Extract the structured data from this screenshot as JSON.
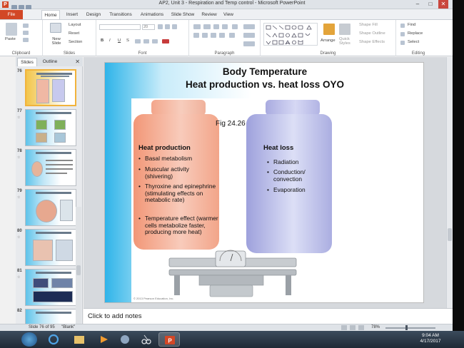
{
  "window": {
    "title": "AP2, Unit 3 - Respiration and Temp control - Microsoft PowerPoint"
  },
  "tabs": [
    "File",
    "Home",
    "Insert",
    "Design",
    "Transitions",
    "Animations",
    "Slide Show",
    "Review",
    "View"
  ],
  "ribbon": {
    "clipboard": {
      "label": "Clipboard",
      "paste": "Paste"
    },
    "slides": {
      "label": "Slides",
      "new_slide": "New Slide",
      "layout": "Layout",
      "reset": "Reset",
      "section": "Section"
    },
    "font": {
      "label": "Font",
      "size": "20"
    },
    "paragraph": {
      "label": "Paragraph"
    },
    "drawing": {
      "label": "Drawing",
      "arrange": "Arrange",
      "quick_styles": "Quick Styles",
      "shape_fill": "Shape Fill",
      "shape_outline": "Shape Outline",
      "shape_effects": "Shape Effects"
    },
    "editing": {
      "label": "Editing",
      "find": "Find",
      "replace": "Replace",
      "select": "Select"
    }
  },
  "left_pane": {
    "tabs": [
      "Slides",
      "Outline"
    ],
    "slides": [
      {
        "num": "76",
        "selected": true
      },
      {
        "num": "77"
      },
      {
        "num": "78"
      },
      {
        "num": "79"
      },
      {
        "num": "80"
      },
      {
        "num": "81"
      },
      {
        "num": "82"
      }
    ]
  },
  "slide": {
    "title_line1": "Body Temperature",
    "title_line2": "Heat production vs. heat loss   OYO",
    "fig_caption": "Fig 24.26",
    "heat_production": {
      "heading": "Heat production",
      "items": [
        "Basal metabolism",
        "Muscular activity (shivering)",
        "Thyroxine and epinephrine (stimulating effects on metabolic rate)",
        "Temperature effect (warmer cells metabolize faster, producing more heat)"
      ]
    },
    "heat_loss": {
      "heading": "Heat loss",
      "items": [
        "Radiation",
        "Conduction/ convection",
        "Evaporation"
      ]
    },
    "copyright": "© 2013 Pearson Education, Inc."
  },
  "notes": {
    "placeholder": "Click to add notes"
  },
  "status": {
    "slide_info": "Slide 76 of 95",
    "theme": "\"Blank\"",
    "zoom": "78%"
  },
  "taskbar": {
    "time": "9:04 AM",
    "date": "4/17/2017"
  }
}
